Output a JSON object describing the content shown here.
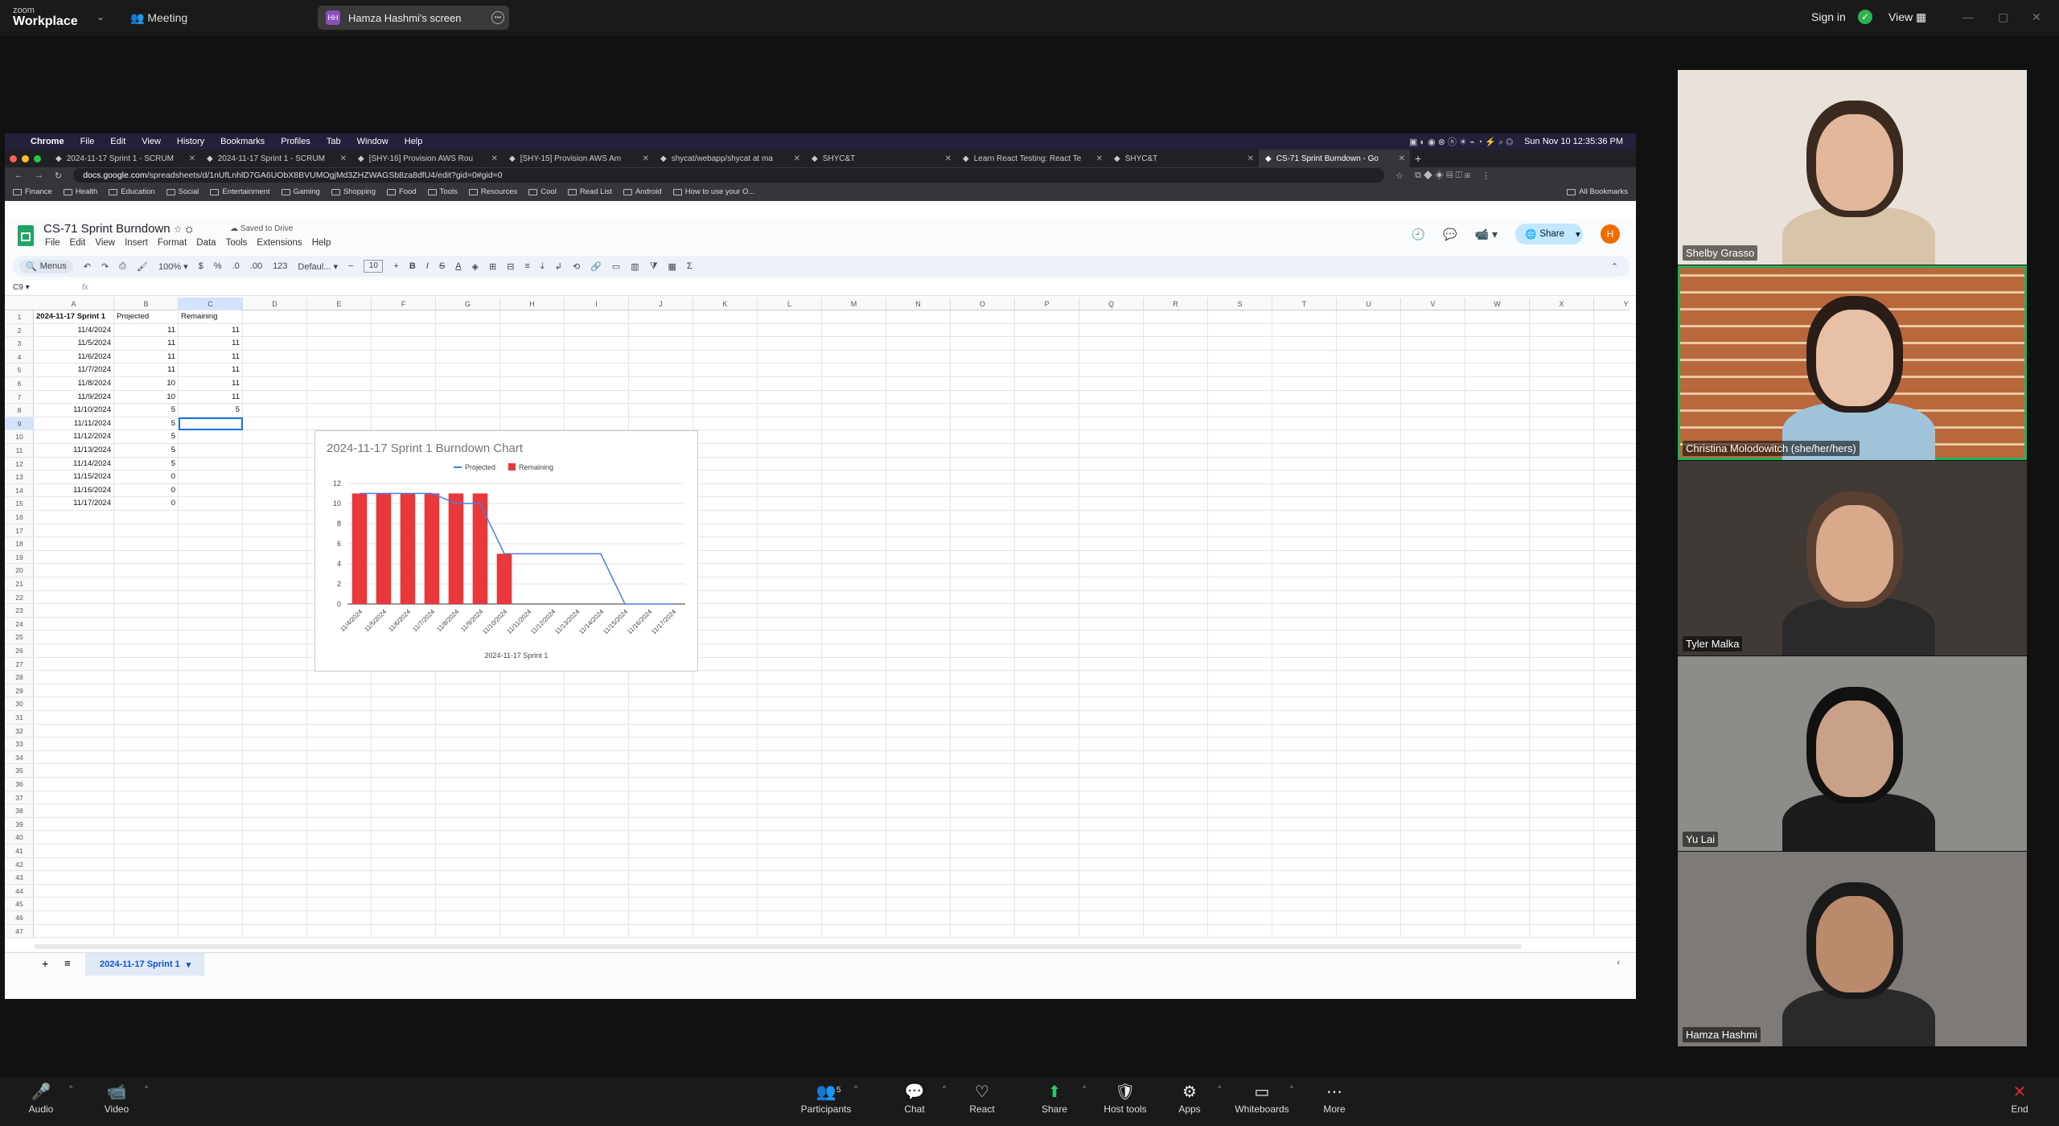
{
  "zoom": {
    "logo_top": "zoom",
    "logo_bottom": "Workplace",
    "meeting_label": "Meeting",
    "screen_initials": "HH",
    "screen_label": "Hamza Hashmi's screen",
    "sign_in": "Sign in",
    "view": "View",
    "toolbar": [
      {
        "id": "audio",
        "label": "Audio",
        "icon": "🎤"
      },
      {
        "id": "video",
        "label": "Video",
        "icon": "📹"
      },
      {
        "id": "participants",
        "label": "Participants",
        "icon": "👥",
        "count": "5"
      },
      {
        "id": "chat",
        "label": "Chat",
        "icon": "💬"
      },
      {
        "id": "react",
        "label": "React",
        "icon": "♡"
      },
      {
        "id": "share",
        "label": "Share",
        "icon": "⬆"
      },
      {
        "id": "host-tools",
        "label": "Host tools",
        "icon": "🛡"
      },
      {
        "id": "apps",
        "label": "Apps",
        "icon": "⚙"
      },
      {
        "id": "whiteboards",
        "label": "Whiteboards",
        "icon": "▭"
      },
      {
        "id": "more",
        "label": "More",
        "icon": "⋯"
      },
      {
        "id": "end",
        "label": "End",
        "icon": "✕"
      }
    ],
    "participants": [
      {
        "name": "Shelby Grasso"
      },
      {
        "name": "Christina Molodowitch (she/her/hers)"
      },
      {
        "name": "Tyler Malka"
      },
      {
        "name": "Yu Lai"
      },
      {
        "name": "Hamza Hashmi"
      }
    ],
    "accent": "#27b05a"
  },
  "mac": {
    "apple": "",
    "menu": [
      "Chrome",
      "File",
      "Edit",
      "View",
      "History",
      "Bookmarks",
      "Profiles",
      "Tab",
      "Window",
      "Help"
    ],
    "clock": "Sun Nov 10  12:35:36 PM"
  },
  "chrome": {
    "tabs": [
      "2024-11-17 Sprint 1 - SCRUM",
      "2024-11-17 Sprint 1 - SCRUM",
      "[SHY-16] Provision AWS Rou",
      "[SHY-15] Provision AWS Am",
      "shycat/webapp/shycat at ma",
      "SHYC&T",
      "Learn React Testing: React Te",
      "SHYC&T",
      "CS-71 Sprint Burndown - Go"
    ],
    "url_host": "docs.google.com",
    "url_path": "/spreadsheets/d/1nUfLnhlD7GA6UObX8BVUMOgjMd3ZHZWAGSb8za8dfU4/edit?gid=0#gid=0",
    "bookmarks": [
      "Finance",
      "Health",
      "Education",
      "Social",
      "Entertainment",
      "Gaming",
      "Shopping",
      "Food",
      "Tools",
      "Resources",
      "Cool",
      "Read List",
      "Android",
      "How to use your O..."
    ],
    "all_bookmarks": "All Bookmarks"
  },
  "sheet": {
    "title": "CS-71 Sprint Burndown",
    "saved": "Saved to Drive",
    "menus": [
      "File",
      "Edit",
      "View",
      "Insert",
      "Format",
      "Data",
      "Tools",
      "Extensions",
      "Help"
    ],
    "share": "Share",
    "avatar": "H",
    "toolbar": {
      "menus": "Menus",
      "zoom": "100%",
      "currency": "$",
      "percent": "%",
      "dec_less": ".0",
      "dec_more": ".00",
      "format": "123",
      "font": "Defaul...",
      "font_size": "10"
    },
    "name_box": "C9",
    "fx": "fx",
    "columns": [
      "A",
      "B",
      "C",
      "D",
      "E",
      "F",
      "G",
      "H",
      "I",
      "J",
      "K",
      "L",
      "M",
      "N",
      "O",
      "P",
      "Q",
      "R",
      "S",
      "T",
      "U",
      "V",
      "W",
      "X",
      "Y"
    ],
    "header_row": [
      "2024-11-17 Sprint 1",
      "Projected",
      "Remaining"
    ],
    "rows": [
      [
        "11/4/2024",
        "11",
        "11"
      ],
      [
        "11/5/2024",
        "11",
        "11"
      ],
      [
        "11/6/2024",
        "11",
        "11"
      ],
      [
        "11/7/2024",
        "11",
        "11"
      ],
      [
        "11/8/2024",
        "10",
        "11"
      ],
      [
        "11/9/2024",
        "10",
        "11"
      ],
      [
        "11/10/2024",
        "5",
        "5"
      ],
      [
        "11/11/2024",
        "5",
        ""
      ],
      [
        "11/12/2024",
        "5",
        ""
      ],
      [
        "11/13/2024",
        "5",
        ""
      ],
      [
        "11/14/2024",
        "5",
        ""
      ],
      [
        "11/15/2024",
        "0",
        ""
      ],
      [
        "11/16/2024",
        "0",
        ""
      ],
      [
        "11/17/2024",
        "0",
        ""
      ]
    ],
    "row_count": 47,
    "sheet_tab": "2024-11-17 Sprint 1"
  },
  "chart_data": {
    "type": "bar",
    "title": "2024-11-17 Sprint 1 Burndown Chart",
    "xlabel": "2024-11-17 Sprint 1",
    "ylabel": "",
    "ylim": [
      0,
      12
    ],
    "yticks": [
      0,
      2,
      4,
      6,
      8,
      10,
      12
    ],
    "legend": "top",
    "categories": [
      "11/4/2024",
      "11/5/2024",
      "11/6/2024",
      "11/7/2024",
      "11/8/2024",
      "11/9/2024",
      "11/10/2024",
      "11/11/2024",
      "11/12/2024",
      "11/13/2024",
      "11/14/2024",
      "11/15/2024",
      "11/16/2024",
      "11/17/2024"
    ],
    "series": [
      {
        "name": "Projected",
        "kind": "line",
        "color": "#4a7ee8",
        "values": [
          11,
          11,
          11,
          11,
          10,
          10,
          5,
          5,
          5,
          5,
          5,
          0,
          0,
          0
        ]
      },
      {
        "name": "Remaining",
        "kind": "bar",
        "color": "#e8383b",
        "values": [
          11,
          11,
          11,
          11,
          11,
          11,
          5,
          null,
          null,
          null,
          null,
          null,
          null,
          null
        ]
      }
    ],
    "grid": true
  }
}
